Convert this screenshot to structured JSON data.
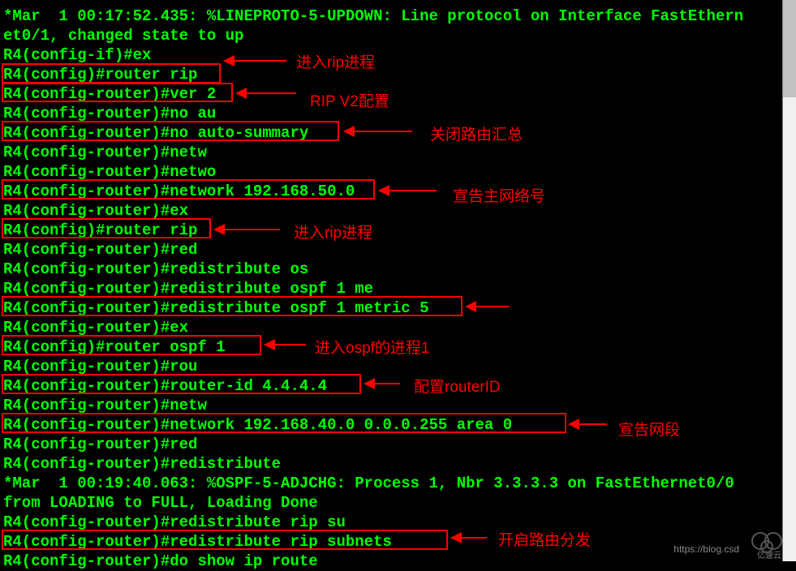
{
  "terminal": {
    "lines": [
      "*Mar  1 00:17:52.435: %LINEPROTO-5-UPDOWN: Line protocol on Interface FastEthern",
      "et0/1, changed state to up",
      "R4(config-if)#ex",
      "R4(config)#router rip",
      "R4(config-router)#ver 2",
      "R4(config-router)#no au",
      "R4(config-router)#no auto-summary",
      "R4(config-router)#netw",
      "R4(config-router)#netwo",
      "R4(config-router)#network 192.168.50.0",
      "R4(config-router)#ex",
      "R4(config)#router rip",
      "R4(config-router)#red",
      "R4(config-router)#redistribute os",
      "R4(config-router)#redistribute ospf 1 me",
      "R4(config-router)#redistribute ospf 1 metric 5",
      "R4(config-router)#ex",
      "R4(config)#router ospf 1",
      "R4(config-router)#rou",
      "R4(config-router)#router-id 4.4.4.4",
      "R4(config-router)#netw",
      "R4(config-router)#network 192.168.40.0 0.0.0.255 area 0",
      "R4(config-router)#red",
      "R4(config-router)#redistribute",
      "*Mar  1 00:19:40.063: %OSPF-5-ADJCHG: Process 1, Nbr 3.3.3.3 on FastEthernet0/0 ",
      "from LOADING to FULL, Loading Done",
      "R4(config-router)#redistribute rip su",
      "R4(config-router)#redistribute rip subnets",
      "R4(config-router)#do show ip route"
    ]
  },
  "annotations": {
    "enter_rip_1": "进入rip进程",
    "rip_v2": "RIP V2配置",
    "no_summary": "关闭路由汇总",
    "declare_net": "宣告主网络号",
    "enter_rip_2": "进入rip进程",
    "enter_ospf": "进入ospf的进程1",
    "router_id": "配置routerID",
    "declare_seg": "宣告网段",
    "redistribute": "开启路由分发"
  },
  "watermark": "https://blog.csd",
  "logo_text": "亿速云"
}
